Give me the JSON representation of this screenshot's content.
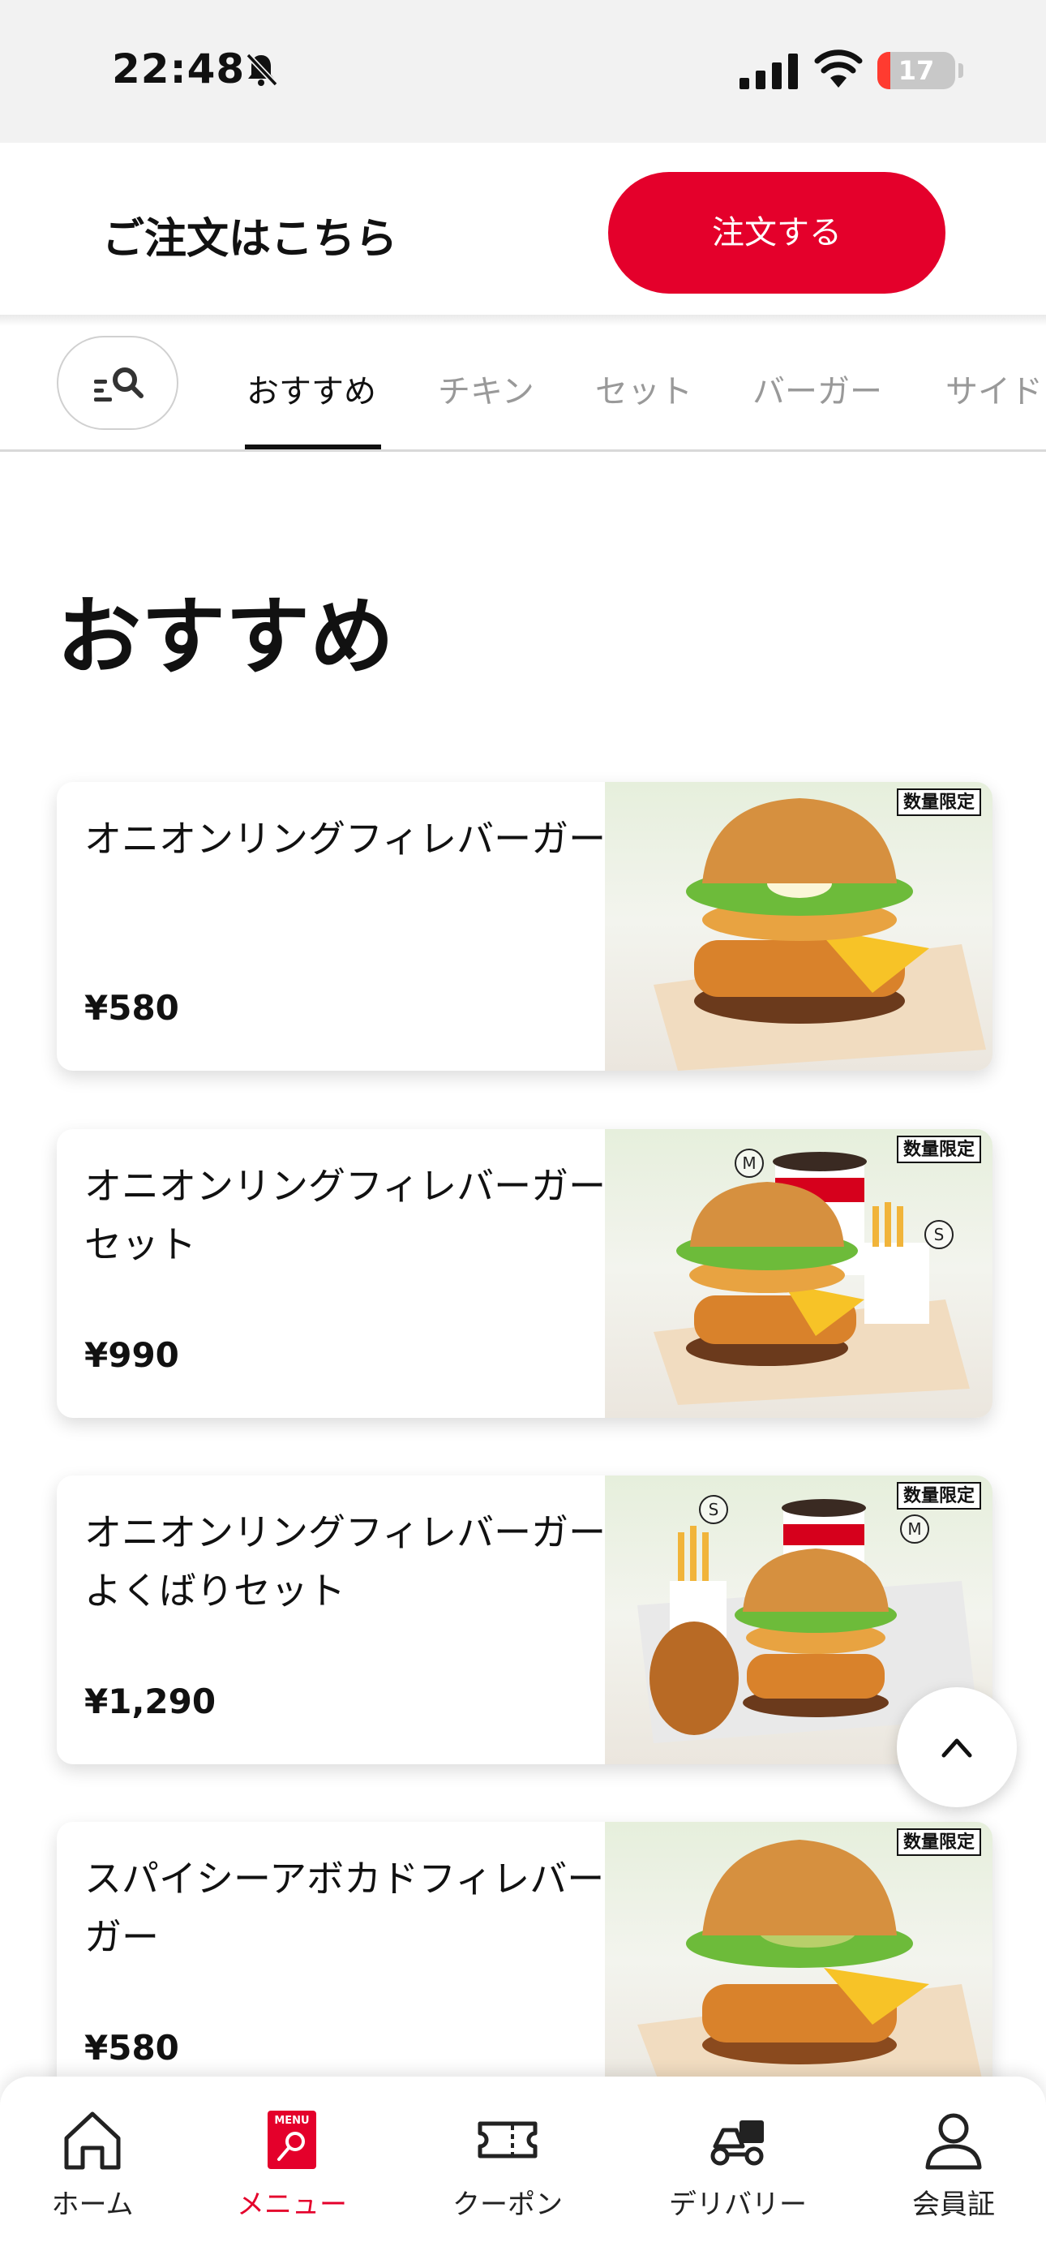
{
  "status_bar": {
    "time": "22:48",
    "battery_level": "17",
    "battery_fraction": 0.17,
    "icons": [
      "bell-slash-icon",
      "signal-icon",
      "wifi-icon",
      "battery-icon"
    ]
  },
  "order_banner": {
    "title": "ご注文はこちら",
    "button_label": "注文する",
    "accent_color": "#e4002b"
  },
  "tabs": {
    "search_icon": "search-list-icon",
    "items": [
      {
        "label": "おすすめ",
        "active": true
      },
      {
        "label": "チキン",
        "active": false
      },
      {
        "label": "セット",
        "active": false
      },
      {
        "label": "バーガー",
        "active": false
      },
      {
        "label": "サイド",
        "active": false
      }
    ]
  },
  "section": {
    "title": "おすすめ"
  },
  "menu_items": [
    {
      "name": "オニオンリングフィレバーガー",
      "price": "¥580",
      "badge": "数量限定",
      "image": "burger-photo"
    },
    {
      "name": "オニオンリングフィレバーガーセット",
      "price": "¥990",
      "badge": "数量限定",
      "image": "burger-set-photo",
      "size_badges": [
        "M",
        "S"
      ]
    },
    {
      "name": "オニオンリングフィレバーガーよくばりセット",
      "price": "¥1,290",
      "badge": "数量限定",
      "image": "burger-big-set-photo",
      "size_badges": [
        "S",
        "M"
      ]
    },
    {
      "name": "スパイシーアボカドフィレバーガー",
      "price": "¥580",
      "badge": "数量限定",
      "image": "avocado-burger-photo"
    }
  ],
  "bottom_nav": {
    "items": [
      {
        "label": "ホーム",
        "icon": "home-icon",
        "active": false
      },
      {
        "label": "メニュー",
        "icon": "menu-icon",
        "icon_text": "MENU",
        "active": true
      },
      {
        "label": "クーポン",
        "icon": "coupon-icon",
        "active": false
      },
      {
        "label": "デリバリー",
        "icon": "delivery-icon",
        "active": false
      },
      {
        "label": "会員証",
        "icon": "member-icon",
        "active": false
      }
    ]
  }
}
